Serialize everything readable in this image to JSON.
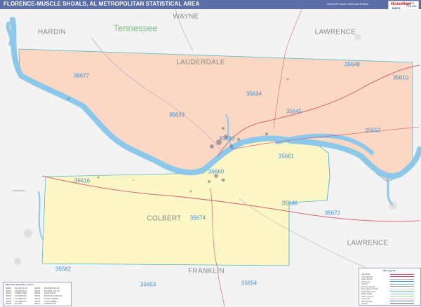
{
  "header": {
    "title": "FLORENCE-MUSCLE SHOALS, AL METROPOLITAN STATISTICAL AREA",
    "edition": "2023 ZIP Code ColorCast Edition",
    "logo": {
      "brand_top": "MarketMaps",
      "brand_bottom": "MAPS",
      "side_text": "MAPS ONLINE"
    }
  },
  "colors": {
    "title_bar": "#5b6ea8",
    "lauderdale_fill": "#fbd8c4",
    "colbert_fill": "#fdf7c6",
    "water": "#8cc8ea",
    "background": "#f3f3f3",
    "zip_label": "#3e8fd0",
    "county_label": "#8a8a8a",
    "state_label": "#7fc28a",
    "county_boundary": "#55b9c9",
    "highway_red": "#d5435c"
  },
  "map": {
    "state_label": "Tennessee",
    "counties": [
      "WAYNE",
      "HARDIN",
      "LAWRENCE",
      "LAUDERDALE",
      "COLBERT",
      "LAWRENCE",
      "FRANKLIN"
    ],
    "zips": [
      "35677",
      "35648",
      "35610",
      "35634",
      "35645",
      "35633",
      "35652",
      "35630",
      "35661",
      "35660",
      "35616",
      "35646",
      "35672",
      "35674",
      "35582",
      "35653",
      "35654"
    ],
    "small_places": [
      "TISHOMINGO"
    ]
  },
  "legend_left": {
    "title": "ZIP Code Index/City Locator",
    "rows": [
      [
        "35582",
        "HALEYVILLE",
        "35653",
        "RUSSELLVILLE"
      ],
      [
        "35610",
        "ANDERSON",
        "35654",
        "RUSSELLVILLE"
      ],
      [
        "35616",
        "CHEROKEE",
        "35660",
        "SHEFFIELD"
      ],
      [
        "35630",
        "FLORENCE",
        "35661",
        "MUSCLE SHOALS"
      ],
      [
        "35633",
        "FLORENCE",
        "35672",
        "TOWN CREEK"
      ],
      [
        "35634",
        "FLORENCE",
        "35674",
        "TUSCUMBIA"
      ],
      [
        "35645",
        "KILLEN",
        "35677",
        "WATERLOO"
      ]
    ]
  },
  "legend_right": {
    "title": "Map Legend",
    "items": [
      "Interstate",
      "US Highway",
      "State Route",
      "ZIP Code",
      "County",
      "Primary Roads",
      "Secondary Roads",
      "State Boundary",
      "Water Body",
      "Park / Forest",
      "City Limit",
      "ZIP Number",
      "Airport"
    ]
  }
}
